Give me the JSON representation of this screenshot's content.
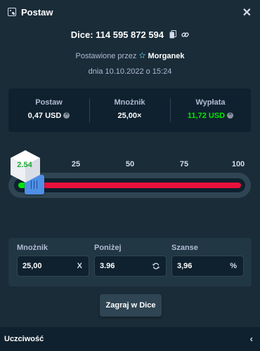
{
  "header": {
    "title": "Postaw",
    "close_icon": "close-icon",
    "dice_icon": "dice-icon"
  },
  "bet": {
    "id_text": "Dice: 114 595 872 594",
    "placed_by_prefix": "Postawione przez",
    "username": "Morganek",
    "date_text": "dnia 10.10.2022 o 15:24"
  },
  "stats": {
    "bet_label": "Postaw",
    "bet_value": "0,47 USD",
    "multiplier_label": "Mnożnik",
    "multiplier_value": "25,00×",
    "payout_label": "Wypłata",
    "payout_value": "11,72 USD"
  },
  "slider": {
    "ticks": [
      "0",
      "25",
      "50",
      "75",
      "100"
    ],
    "result": "2.54",
    "value": 3.96,
    "range": [
      0,
      100
    ],
    "colors": {
      "win": "#00e701",
      "lose": "#e9113c",
      "handle": "#4f8fe6"
    }
  },
  "inputs": {
    "multiplier_label": "Mnożnik",
    "multiplier_value": "25,00",
    "multiplier_suffix": "X",
    "under_label": "Poniżej",
    "under_value": "3.96",
    "chance_label": "Szanse",
    "chance_value": "3,96",
    "chance_suffix": "%"
  },
  "play_button": "Zagraj w Dice",
  "footer": {
    "label": "Uczciwość"
  }
}
